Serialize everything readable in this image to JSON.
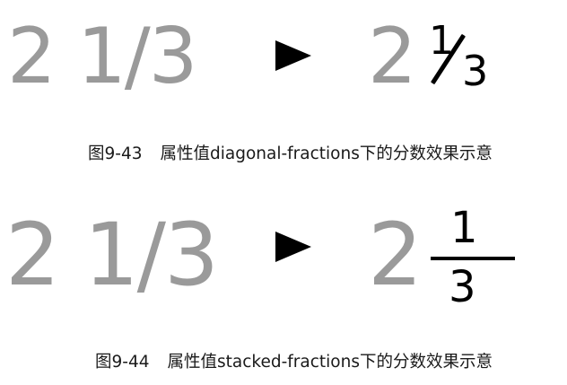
{
  "figure1": {
    "input_text": "2 1/3",
    "result_whole": "2",
    "result_numerator": "1",
    "result_denominator": "3",
    "caption_number": "图9-43",
    "caption_text": "属性值diagonal-fractions下的分数效果示意"
  },
  "figure2": {
    "input_text": "2 1/3",
    "result_whole": "2",
    "result_numerator": "1",
    "result_denominator": "3",
    "caption_number": "图9-44",
    "caption_text": "属性值stacked-fractions下的分数效果示意"
  },
  "icons": {
    "arrow": "right-triangle-arrow"
  },
  "colors": {
    "input_text": "#9a9a9a",
    "result_whole": "#9a9a9a",
    "fraction": "#000000",
    "caption": "#1a1a1a"
  }
}
